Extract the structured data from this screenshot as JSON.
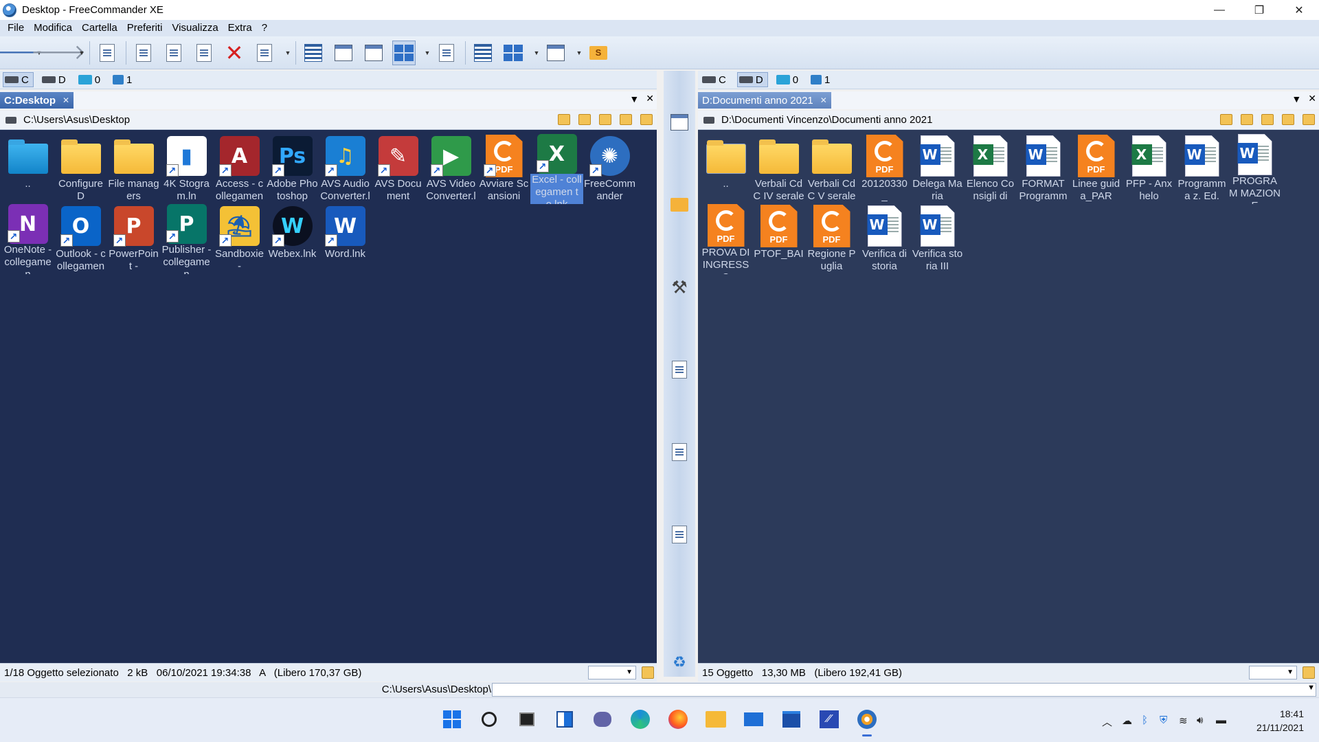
{
  "window": {
    "title": "Desktop - FreeCommander XE",
    "controls": {
      "minimize": "—",
      "restore": "❐",
      "close": "✕"
    }
  },
  "menu": [
    "File",
    "Modifica",
    "Cartella",
    "Preferiti",
    "Visualizza",
    "Extra",
    "?"
  ],
  "toolbar": {
    "icons": [
      "back-arrow-icon",
      "forward-arrow-icon",
      "view-file-icon",
      "edit-file-icon",
      "new-file-icon",
      "copy-file-icon",
      "delete-icon",
      "properties-icon",
      "details-view-icon",
      "brief-view-icon",
      "list-view-icon",
      "thumbnails-view-icon",
      "refresh-icon",
      "checklist-icon",
      "layout-icon",
      "settings-icon",
      "favorites-folder-icon"
    ],
    "folder_badge": "S"
  },
  "left": {
    "drives": [
      {
        "label": "C",
        "type": "disk",
        "active": true
      },
      {
        "label": "D",
        "type": "disk",
        "active": false
      },
      {
        "label": "0",
        "type": "net",
        "active": false
      },
      {
        "label": "1",
        "type": "net2",
        "active": false
      }
    ],
    "tab": {
      "label": "C:Desktop",
      "close": "✕"
    },
    "path": "C:\\Users\\Asus\\Desktop",
    "status": "1/18 Oggetto selezionato   2 kB   06/10/2021 19:34:38   A   (Libero 170,37 GB)",
    "items": [
      {
        "label": "..",
        "kind": "folder-blue"
      },
      {
        "label": "ConfigureD",
        "kind": "folder"
      },
      {
        "label": "File managers",
        "kind": "folder"
      },
      {
        "label": "4K Stogram.ln",
        "kind": "app",
        "glyph": "▮",
        "color": "#ffffff",
        "fg": "#1e78d8",
        "shortcut": true
      },
      {
        "label": "Access - collegamen",
        "kind": "app",
        "glyph": "A",
        "color": "#a4262c",
        "fg": "#ffffff",
        "shortcut": true
      },
      {
        "label": "Adobe Photoshop",
        "kind": "app",
        "glyph": "Ps",
        "color": "#0b1b34",
        "fg": "#31a8ff",
        "shortcut": true
      },
      {
        "label": "AVS Audio Converter.l",
        "kind": "app",
        "glyph": "♫",
        "color": "#1a7fd4",
        "fg": "#ffd23f",
        "shortcut": true
      },
      {
        "label": "AVS Document",
        "kind": "app",
        "glyph": "✎",
        "color": "#c43b3b",
        "fg": "#ffffff",
        "shortcut": true
      },
      {
        "label": "AVS Video Converter.l",
        "kind": "app",
        "glyph": "▶",
        "color": "#2f9a4a",
        "fg": "#ffffff",
        "shortcut": true
      },
      {
        "label": "Avviare Scansioni",
        "kind": "pdf",
        "shortcut": true
      },
      {
        "label": "Excel - collegamen to.lnk",
        "kind": "app",
        "glyph": "X",
        "color": "#1d7a45",
        "fg": "#ffffff",
        "shortcut": true,
        "selected": true
      },
      {
        "label": "FreeComm ander",
        "kind": "app",
        "glyph": "✺",
        "color": "#2d6ec0",
        "fg": "#ffffff",
        "shortcut": true,
        "round": true
      },
      {
        "label": "OneNote - collegamen",
        "kind": "app",
        "glyph": "N",
        "color": "#7b2fb5",
        "fg": "#ffffff",
        "shortcut": true
      },
      {
        "label": "Outlook - collegamen",
        "kind": "app",
        "glyph": "O",
        "color": "#0a64c8",
        "fg": "#ffffff",
        "shortcut": true
      },
      {
        "label": "PowerPoint -",
        "kind": "app",
        "glyph": "P",
        "color": "#c9472b",
        "fg": "#ffffff",
        "shortcut": true
      },
      {
        "label": "Publisher - collegamen",
        "kind": "app",
        "glyph": "P",
        "color": "#077568",
        "fg": "#ffffff",
        "shortcut": true
      },
      {
        "label": "Sandboxie-",
        "kind": "app",
        "glyph": "⛱",
        "color": "#f4c136",
        "fg": "#1b5fb0",
        "shortcut": true
      },
      {
        "label": "Webex.lnk",
        "kind": "app",
        "glyph": "W",
        "color": "#0b1020",
        "fg": "#35d0ff",
        "shortcut": true,
        "round": true
      },
      {
        "label": "Word.lnk",
        "kind": "app",
        "glyph": "W",
        "color": "#185abd",
        "fg": "#ffffff",
        "shortcut": true
      }
    ]
  },
  "right": {
    "drives": [
      {
        "label": "C",
        "type": "disk",
        "active": false
      },
      {
        "label": "D",
        "type": "disk",
        "active": true
      },
      {
        "label": "0",
        "type": "net",
        "active": false
      },
      {
        "label": "1",
        "type": "net2",
        "active": false
      }
    ],
    "tab": {
      "label": "D:Documenti anno 2021",
      "close": "✕"
    },
    "path": "D:\\Documenti Vincenzo\\Documenti anno 2021",
    "status": "15 Oggetto   13,30 MB   (Libero 192,41 GB)",
    "items": [
      {
        "label": "..",
        "kind": "folder-up"
      },
      {
        "label": "Verbali CdC IV serale",
        "kind": "folder"
      },
      {
        "label": "Verbali CdC V serale",
        "kind": "folder"
      },
      {
        "label": "20120330_",
        "kind": "pdf"
      },
      {
        "label": "Delega Maria",
        "kind": "word"
      },
      {
        "label": "Elenco Consigli di",
        "kind": "excel"
      },
      {
        "label": "FORMAT Programm",
        "kind": "word"
      },
      {
        "label": "Linee guida_PAR",
        "kind": "pdf"
      },
      {
        "label": "PFP - Anxhelo",
        "kind": "excel"
      },
      {
        "label": "Programma z. Ed.",
        "kind": "word"
      },
      {
        "label": "PROGRAM MAZIONE",
        "kind": "word"
      },
      {
        "label": "PROVA DI INGRESSO",
        "kind": "pdf"
      },
      {
        "label": "PTOF_BAI",
        "kind": "pdf"
      },
      {
        "label": "Regione Puglia",
        "kind": "pdf"
      },
      {
        "label": "Verifica di storia",
        "kind": "word"
      },
      {
        "label": "Verifica storia III",
        "kind": "word"
      }
    ]
  },
  "pane_controls": {
    "dropdown": "▼",
    "close": "✕"
  },
  "command_line": {
    "prompt": "C:\\Users\\Asus\\Desktop\\",
    "value": ""
  },
  "taskbar": {
    "apps": [
      "start-icon",
      "search-icon",
      "task-view-icon",
      "widgets-icon",
      "teams-chat-icon",
      "edge-icon",
      "firefox-icon",
      "file-explorer-icon",
      "mail-icon",
      "store-icon",
      "remote-app-icon",
      "freecommander-icon"
    ],
    "tray": [
      "chevron-up-icon",
      "onedrive-icon",
      "bluetooth-icon",
      "security-icon",
      "wifi-icon",
      "volume-icon",
      "battery-icon"
    ],
    "time": "18:41",
    "date": "21/11/2021"
  },
  "colors": {
    "accent": "#3a66aa",
    "pane_left_bg": "#1f2d52",
    "pane_right_bg": "#2c3a5a",
    "pdf": "#f5821f",
    "word": "#185abd",
    "excel": "#1d7a45"
  }
}
